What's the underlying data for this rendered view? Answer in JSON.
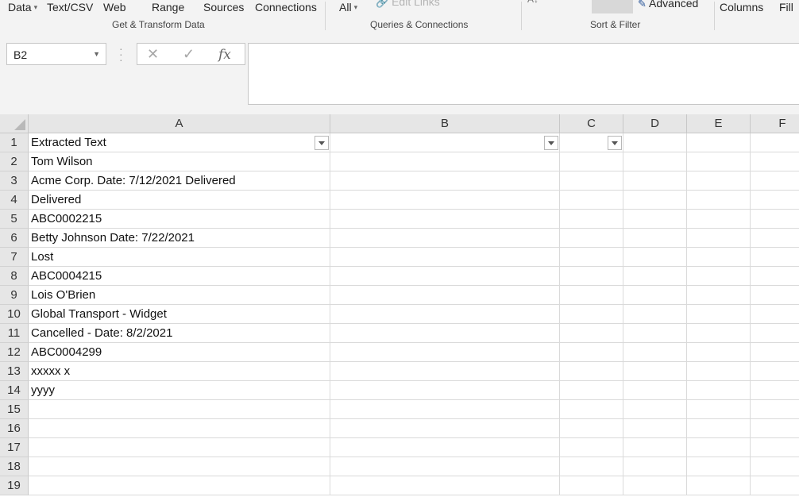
{
  "ribbon": {
    "items": [
      {
        "name": "get-data-button",
        "label": "Data",
        "caret": true,
        "dim": false
      },
      {
        "name": "from-text-csv-button",
        "label": "Text/CSV",
        "caret": false,
        "dim": false
      },
      {
        "name": "from-web-button",
        "label": "Web",
        "caret": false,
        "dim": false
      },
      {
        "name": "from-range-button",
        "label": "Range",
        "caret": false,
        "dim": false
      },
      {
        "name": "recent-sources-button",
        "label": "Sources",
        "caret": false,
        "dim": false
      },
      {
        "name": "existing-connections-button",
        "label": "Connections",
        "caret": false,
        "dim": false
      },
      {
        "name": "refresh-all-button",
        "label": "All",
        "caret": true,
        "dim": false
      },
      {
        "name": "edit-links-button",
        "label": "Edit Links",
        "caret": false,
        "dim": true
      },
      {
        "name": "advanced-filter-button",
        "label": "Advanced",
        "caret": false,
        "dim": false
      },
      {
        "name": "text-to-columns-button",
        "label": "Columns",
        "caret": false,
        "dim": false
      },
      {
        "name": "flash-fill-button",
        "label": "Fill",
        "caret": false,
        "dim": false
      }
    ],
    "groups": [
      {
        "name": "group-get-transform",
        "label": "Get & Transform Data"
      },
      {
        "name": "group-queries-connections",
        "label": "Queries & Connections"
      },
      {
        "name": "group-sort-filter",
        "label": "Sort & Filter"
      }
    ]
  },
  "formula_bar": {
    "name_box": "B2",
    "cancel_glyph": "✕",
    "enter_glyph": "✓",
    "fx_label": "fx",
    "formula": ""
  },
  "grid": {
    "columns": [
      "A",
      "B",
      "C",
      "D",
      "E",
      "F"
    ],
    "rows": [
      "1",
      "2",
      "3",
      "4",
      "5",
      "6",
      "7",
      "8",
      "9",
      "10",
      "11",
      "12",
      "13",
      "14",
      "15",
      "16",
      "17",
      "18",
      "19"
    ],
    "column_a_values": [
      "Extracted Text",
      "Tom Wilson",
      "Acme Corp.  Date: 7/12/2021 Delivered",
      "Delivered",
      "ABC0002215",
      "Betty Johnson Date: 7/22/2021",
      "Lost",
      "ABC0004215",
      "Lois O'Brien",
      "Global Transport - Widget",
      "Cancelled - Date: 8/2/2021",
      "ABC0004299",
      "xxxxx x",
      "yyyy",
      "",
      "",
      "",
      "",
      ""
    ]
  },
  "colors": {
    "ribbon_bg": "#f3f3f3",
    "header_bg": "#e6e6e6",
    "gridline": "#dadada"
  }
}
